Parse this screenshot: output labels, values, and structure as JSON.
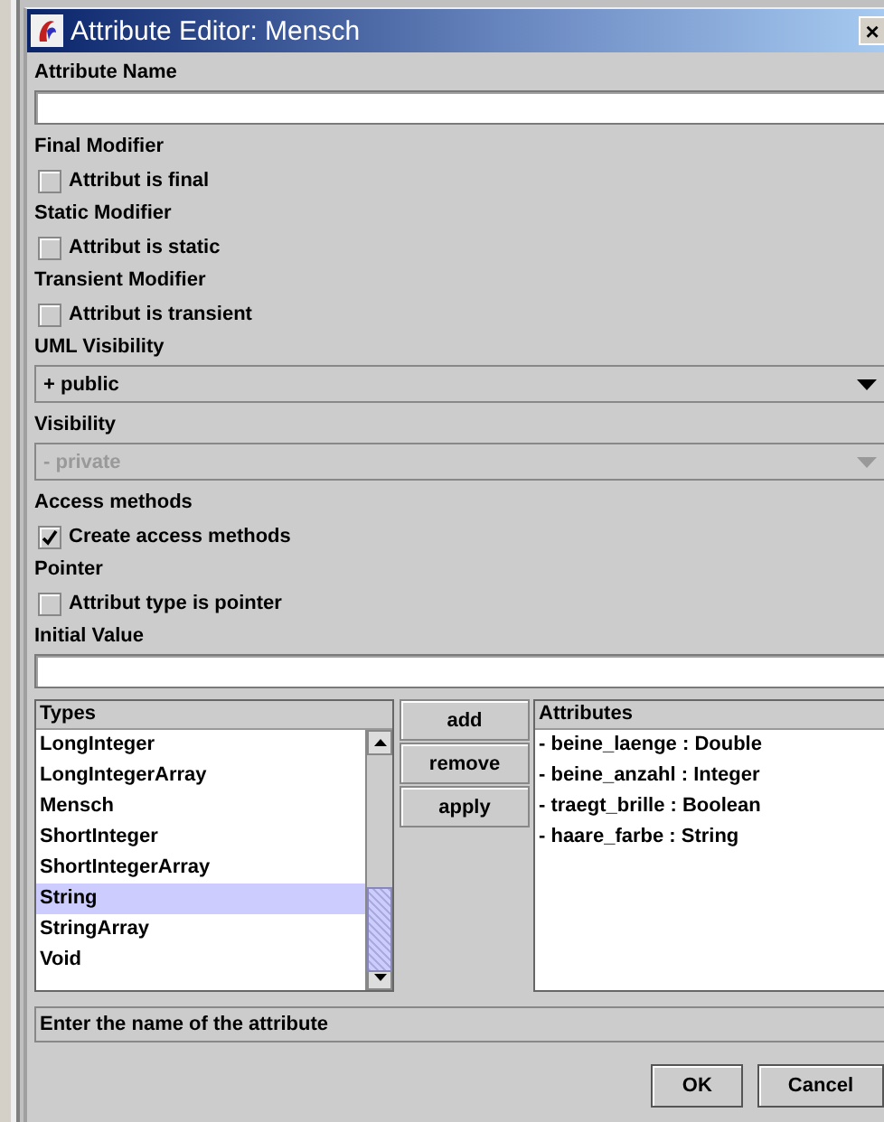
{
  "window": {
    "title": "Attribute Editor: Mensch",
    "close": "×"
  },
  "form": [
    {
      "kind": "heading",
      "label": "Attribute Name"
    },
    {
      "kind": "text"
    },
    {
      "kind": "heading",
      "label": "Final Modifier"
    },
    {
      "kind": "checkbox",
      "label": "Attribut is final",
      "checked": false
    },
    {
      "kind": "heading",
      "label": "Static Modifier"
    },
    {
      "kind": "checkbox",
      "label": "Attribut is static",
      "checked": false
    },
    {
      "kind": "heading",
      "label": "Transient Modifier"
    },
    {
      "kind": "checkbox",
      "label": "Attribut is transient",
      "checked": false
    },
    {
      "kind": "heading",
      "label": "UML Visibility"
    },
    {
      "kind": "combo",
      "value": "+ public",
      "disabled": false
    },
    {
      "kind": "heading",
      "label": "Visibility"
    },
    {
      "kind": "combo",
      "value": "- private",
      "disabled": true
    },
    {
      "kind": "heading",
      "label": "Access methods"
    },
    {
      "kind": "checkbox",
      "label": "Create access methods",
      "checked": true
    },
    {
      "kind": "heading",
      "label": "Pointer"
    },
    {
      "kind": "checkbox",
      "label": "Attribut type is pointer",
      "checked": false
    },
    {
      "kind": "heading",
      "label": "Initial Value"
    },
    {
      "kind": "text"
    }
  ],
  "types": {
    "header": "Types",
    "items": [
      {
        "label": "LongInteger",
        "selected": false
      },
      {
        "label": "LongIntegerArray",
        "selected": false
      },
      {
        "label": "Mensch",
        "selected": false
      },
      {
        "label": "ShortInteger",
        "selected": false
      },
      {
        "label": "ShortIntegerArray",
        "selected": false
      },
      {
        "label": "String",
        "selected": true
      },
      {
        "label": "StringArray",
        "selected": false
      },
      {
        "label": "Void",
        "selected": false
      }
    ]
  },
  "actions": [
    "add",
    "remove",
    "apply"
  ],
  "attributes": {
    "header": "Attributes",
    "items": [
      "- beine_laenge : Double",
      "- beine_anzahl : Integer",
      "- traegt_brille : Boolean",
      "- haare_farbe : String"
    ]
  },
  "status": "Enter the name of the attribute",
  "buttons": [
    "OK",
    "Cancel"
  ]
}
